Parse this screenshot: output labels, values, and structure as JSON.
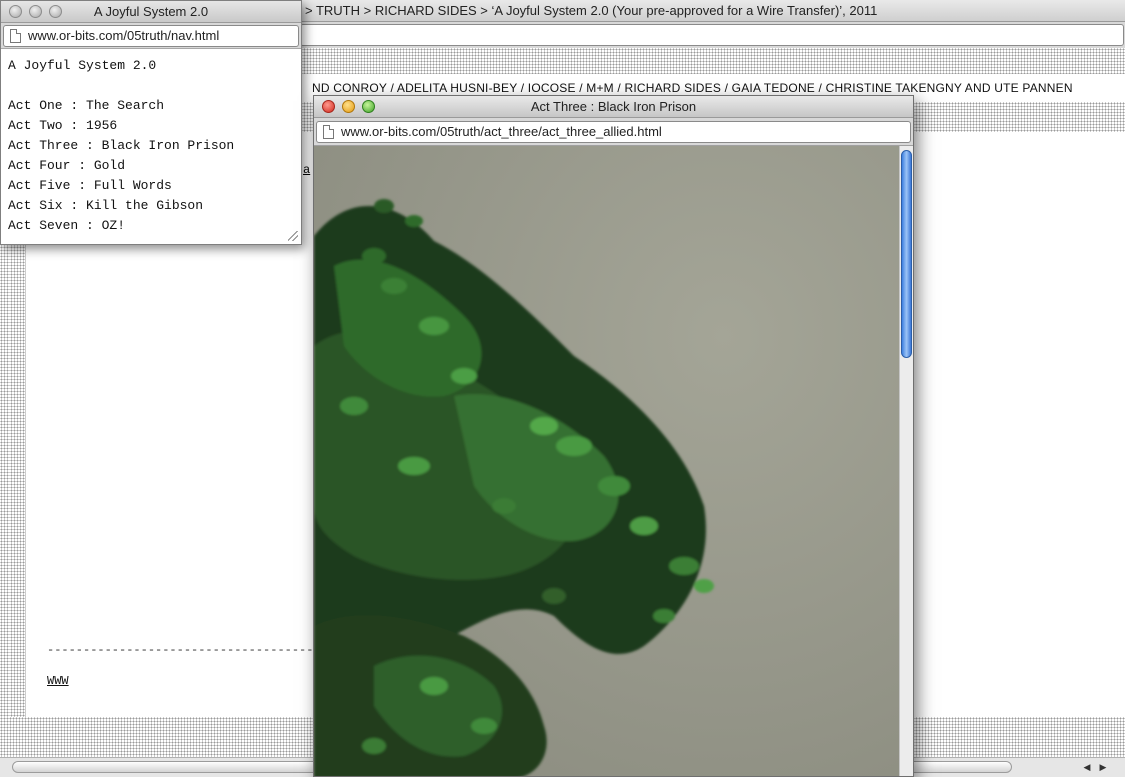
{
  "main_window": {
    "title": "A Joyful System 2.0 > TRUTH > RICHARD SIDES > ‘A Joyful System 2.0 (Your pre-approved for a Wire Transfer)’, 2011",
    "title_visible": "> TRUTH > RICHARD SIDES > ‘A Joyful System 2.0 (Your pre-approved for a Wire Transfer)’, 2011",
    "artists_line": "ND CONROY  /  ADELITA HUSNI-BEY  /  IOCOSE  /  M+M  /  RICHARD SIDES  /  GAIA TEDONE  /  CHRISTINE TAKENGNY AND UTE PANNEN",
    "stray_glyph": "a",
    "dashes": "-------------------------------------",
    "www_link": "WWW"
  },
  "nav_window": {
    "title": "A Joyful System 2.0",
    "url": "www.or-bits.com/05truth/nav.html",
    "heading": "A Joyful System 2.0",
    "items": [
      {
        "label": "Act One : The Search"
      },
      {
        "label": "Act Two : 1956"
      },
      {
        "label": "Act Three : Black Iron Prison"
      },
      {
        "label": "Act Four : Gold"
      },
      {
        "label": "Act Five : Full Words"
      },
      {
        "label": "Act Six : Kill the Gibson"
      },
      {
        "label": "Act Seven : OZ!"
      }
    ]
  },
  "act_window": {
    "title": "Act Three : Black Iron Prison",
    "url": "www.or-bits.com/05truth/act_three/act_three_allied.html",
    "photo_description_icon": "tree-photo"
  },
  "colors": {
    "photo_background": "#959689",
    "foliage_dark": "#1f3a1c",
    "foliage_light": "#3f8a3a",
    "scroll_blue": "#3c7fe0"
  }
}
